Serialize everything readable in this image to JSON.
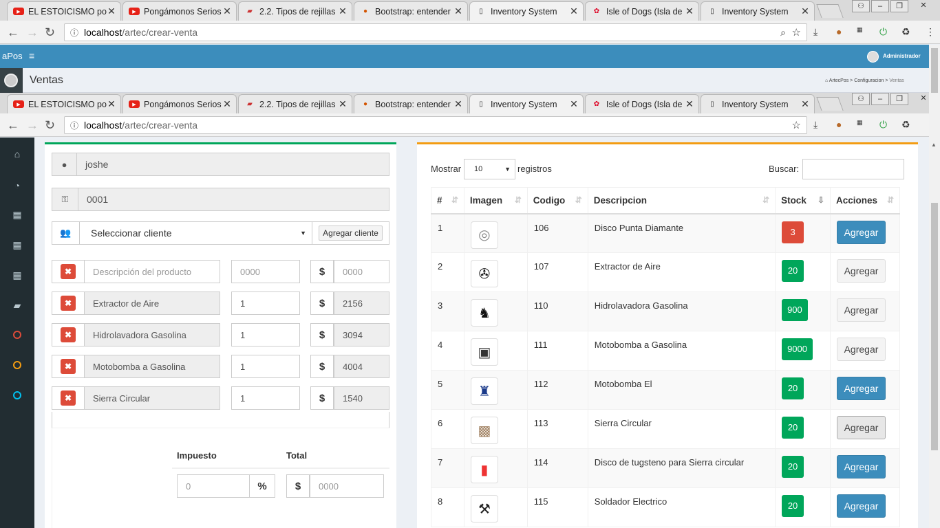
{
  "browser": {
    "tabs": [
      {
        "title": "EL ESTOICISMO por",
        "favicon": "youtube-icon"
      },
      {
        "title": "Pongámonos Serios",
        "favicon": "youtube-icon"
      },
      {
        "title": "2.2. Tipos de rejillas",
        "favicon": "book-icon"
      },
      {
        "title": "Bootstrap: entender",
        "favicon": "firefox-icon"
      },
      {
        "title": "Inventory System",
        "favicon": "page-icon"
      },
      {
        "title": "Isle of Dogs (Isla de",
        "favicon": "film-reel-icon"
      },
      {
        "title": "Inventory System",
        "favicon": "page-icon"
      }
    ],
    "url_host": "localhost",
    "url_path": "/artec/crear-venta"
  },
  "app": {
    "logo": "aPos",
    "menu_toggle": "≡",
    "user_name": "Administrador",
    "page_title": "Ventas",
    "breadcrumb": [
      "ArtecPos",
      "Configuracion",
      "Ventas"
    ]
  },
  "sidebar": {
    "icons": [
      "home-icon",
      "dashboard-icon",
      "table-icon",
      "table-icon",
      "table-icon",
      "book-icon",
      "circle-red-icon",
      "circle-orange-icon",
      "circle-blue-icon"
    ],
    "circle_colors": [
      "#dd4b39",
      "#f39c12",
      "#00c0ef"
    ]
  },
  "sale_form": {
    "seller": "joshe",
    "sale_code": "0001",
    "client_select": "Seleccionar cliente",
    "add_client_button": "Agregar cliente",
    "new_product": {
      "description_placeholder": "Descripción del producto",
      "qty_placeholder": "0000",
      "price_placeholder": "0000"
    },
    "products": [
      {
        "description": "Extractor de Aire",
        "qty": "1",
        "price": "2156"
      },
      {
        "description": "Hidrolavadora Gasolina",
        "qty": "1",
        "price": "3094"
      },
      {
        "description": "Motobomba a Gasolina",
        "qty": "1",
        "price": "4004"
      },
      {
        "description": "Sierra Circular",
        "qty": "1",
        "price": "1540"
      }
    ],
    "currency": "$",
    "tax_label": "Impuesto",
    "total_label": "Total",
    "tax_placeholder": "0",
    "percent": "%",
    "total_placeholder": "0000"
  },
  "products_table": {
    "show_label": "Mostrar",
    "page_size": "10",
    "records_label": "registros",
    "search_label": "Buscar:",
    "columns": [
      "#",
      "Imagen",
      "Codigo",
      "Descripcion",
      "Stock",
      "Acciones"
    ],
    "rows": [
      {
        "n": "1",
        "code": "106",
        "desc": "Disco Punta Diamante",
        "stock": "3",
        "stock_color": "#dd4b39",
        "action": "Agregar",
        "action_style": "primary"
      },
      {
        "n": "2",
        "code": "107",
        "desc": "Extractor de Aire",
        "stock": "20",
        "stock_color": "#00a65a",
        "action": "Agregar",
        "action_style": "default"
      },
      {
        "n": "3",
        "code": "110",
        "desc": "Hidrolavadora Gasolina",
        "stock": "900",
        "stock_color": "#00a65a",
        "action": "Agregar",
        "action_style": "default"
      },
      {
        "n": "4",
        "code": "111",
        "desc": "Motobomba a Gasolina",
        "stock": "9000",
        "stock_color": "#00a65a",
        "action": "Agregar",
        "action_style": "default"
      },
      {
        "n": "5",
        "code": "112",
        "desc": "Motobomba El",
        "stock": "20",
        "stock_color": "#00a65a",
        "action": "Agregar",
        "action_style": "primary"
      },
      {
        "n": "6",
        "code": "113",
        "desc": "Sierra Circular",
        "stock": "20",
        "stock_color": "#00a65a",
        "action": "Agregar",
        "action_style": "hover"
      },
      {
        "n": "7",
        "code": "114",
        "desc": "Disco de tugsteno para Sierra circular",
        "stock": "20",
        "stock_color": "#00a65a",
        "action": "Agregar",
        "action_style": "primary"
      },
      {
        "n": "8",
        "code": "115",
        "desc": "Soldador Electrico",
        "stock": "20",
        "stock_color": "#00a65a",
        "action": "Agregar",
        "action_style": "primary"
      }
    ]
  }
}
